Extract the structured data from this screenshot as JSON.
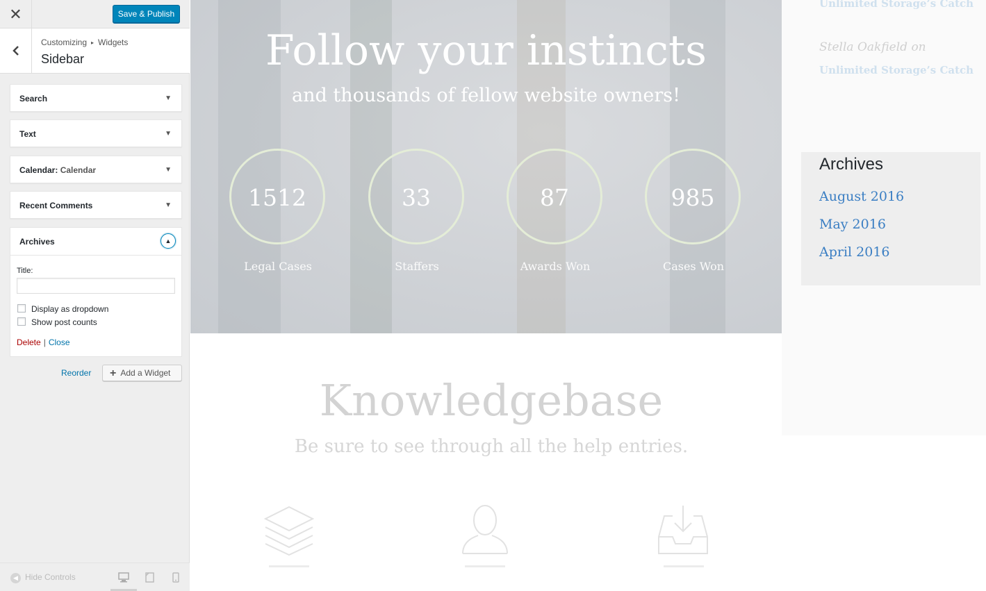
{
  "toolbar": {
    "close": "✕",
    "publish_label": "Save & Publish"
  },
  "section": {
    "back": "‹",
    "breadcrumb": [
      "Customizing",
      "Widgets"
    ],
    "title": "Sidebar"
  },
  "widgets": [
    {
      "label": "Search",
      "sub": ""
    },
    {
      "label": "Text",
      "sub": ""
    },
    {
      "label": "Calendar",
      "sub": "Calendar"
    },
    {
      "label": "Recent Comments",
      "sub": ""
    }
  ],
  "archives_widget": {
    "label": "Archives",
    "title_label": "Title:",
    "title_value": "",
    "dropdown_label": "Display as dropdown",
    "counts_label": "Show post counts",
    "delete_label": "Delete",
    "separator": "|",
    "close_label": "Close"
  },
  "actions": {
    "reorder": "Reorder",
    "add_widget": "Add a Widget"
  },
  "footer": {
    "hide_controls": "Hide Controls"
  },
  "preview": {
    "hero_title": "Follow your instincts",
    "hero_sub": "and thousands of fellow website owners!",
    "stats": [
      {
        "value": "1512",
        "label": "Legal Cases"
      },
      {
        "value": "33",
        "label": "Staffers"
      },
      {
        "value": "87",
        "label": "Awards Won"
      },
      {
        "value": "985",
        "label": "Cases Won"
      }
    ],
    "kb_title": "Knowledgebase",
    "kb_sub": "Be sure to see through all the help entries."
  },
  "sidebar_preview": {
    "rc_top": "Unlimited Storage’s Catch",
    "rc_author": "Stella Oakfield on",
    "rc_link": "Unlimited Storage’s Catch",
    "archives_title": "Archives",
    "archives": [
      "August 2016",
      "May 2016",
      "April 2016"
    ]
  },
  "colors": {
    "primary": "#0085ba",
    "link": "#0073aa",
    "delete": "#aa0000",
    "archive_link": "#3a7ec3"
  },
  "icons": [
    "close-icon",
    "back-icon",
    "arrow-down-icon",
    "arrow-up-icon",
    "plus-icon",
    "hide-controls-icon",
    "desktop-icon",
    "tablet-icon",
    "mobile-icon",
    "layers-icon",
    "user-icon",
    "inbox-download-icon"
  ]
}
